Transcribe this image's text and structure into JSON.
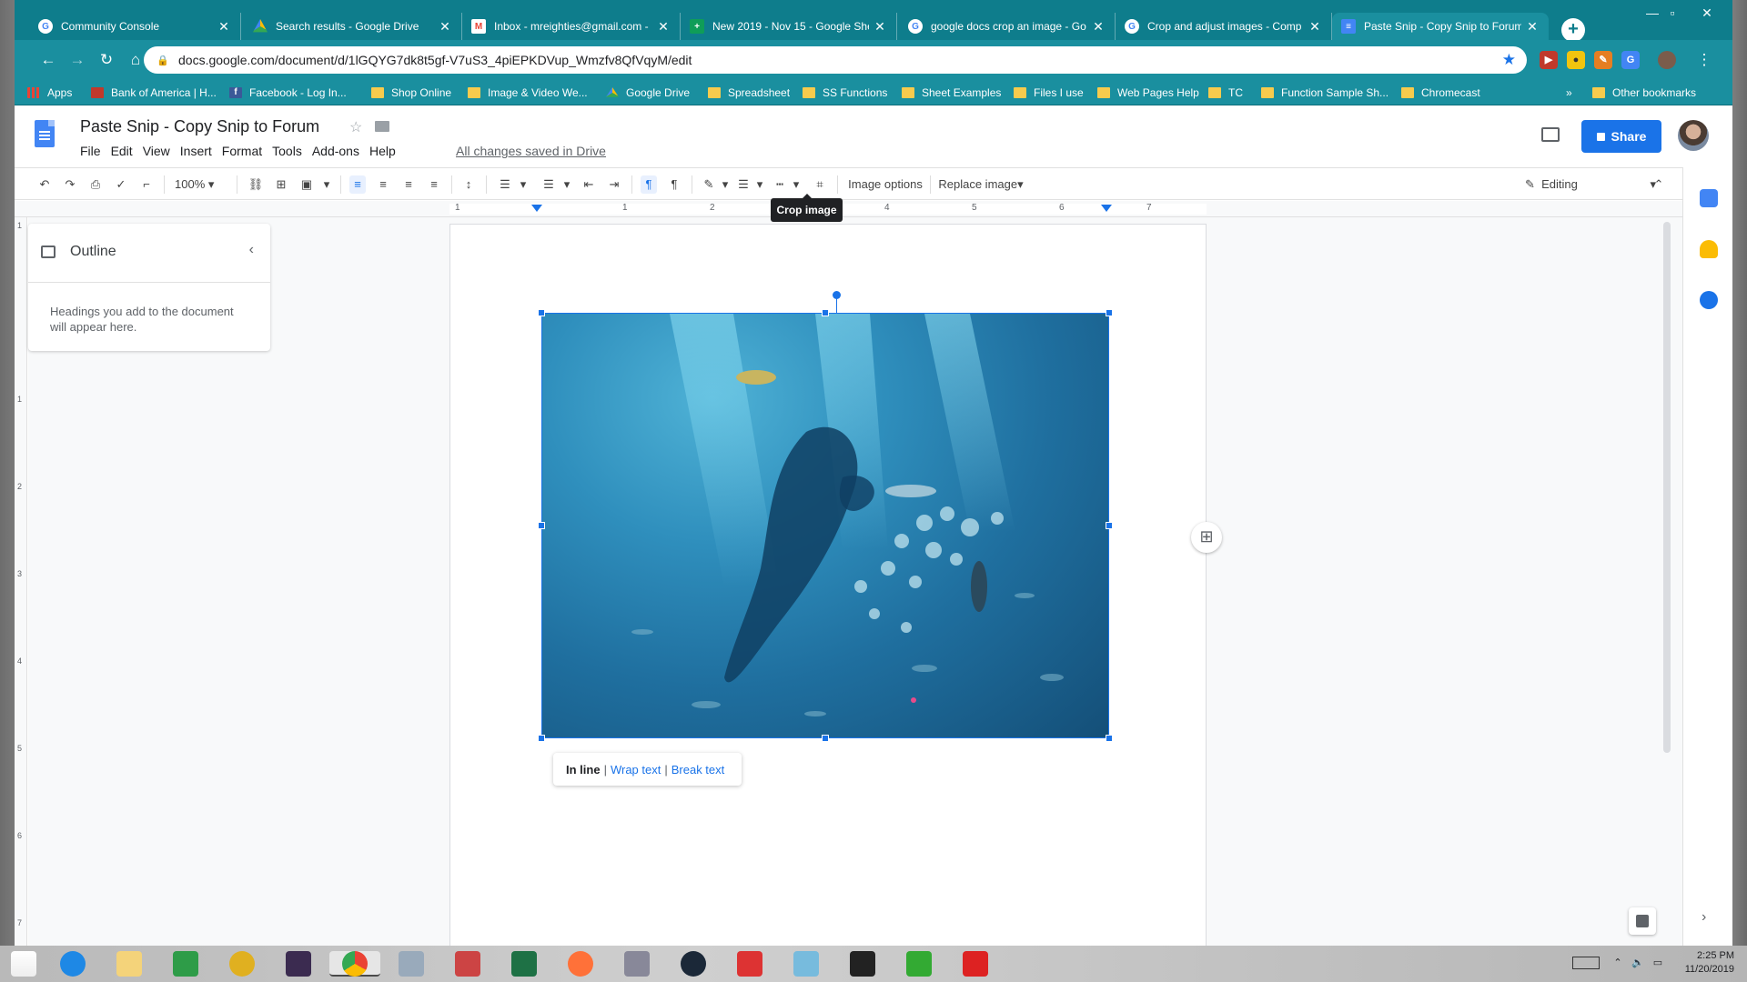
{
  "tabs": [
    {
      "title": "Community Console",
      "favicon": "google"
    },
    {
      "title": "Search results - Google Drive",
      "favicon": "drive"
    },
    {
      "title": "Inbox - mreighties@gmail.com -",
      "favicon": "gmail"
    },
    {
      "title": "New 2019 - Nov 15 - Google She",
      "favicon": "sheets"
    },
    {
      "title": "google docs crop an image - Go",
      "favicon": "google"
    },
    {
      "title": "Crop and adjust images - Comp",
      "favicon": "google"
    },
    {
      "title": "Paste Snip - Copy Snip to Forum",
      "favicon": "docs",
      "active": true
    }
  ],
  "omnibox": {
    "url": "docs.google.com/document/d/1lGQYG7dk8t5gf-V7uS3_4piEPKDVup_Wmzfv8QfVqyM/edit"
  },
  "bookmarks": [
    {
      "label": "Apps",
      "icon": "apps-icon"
    },
    {
      "label": "Bank of America | H...",
      "icon": "bofa-icon"
    },
    {
      "label": "Facebook - Log In...",
      "icon": "facebook-icon"
    },
    {
      "label": "Shop Online",
      "icon": "folder-icon"
    },
    {
      "label": "Image & Video We...",
      "icon": "folder-icon"
    },
    {
      "label": "Google Drive",
      "icon": "drive-icon"
    },
    {
      "label": "Spreadsheet",
      "icon": "folder-icon"
    },
    {
      "label": "SS Functions",
      "icon": "folder-icon"
    },
    {
      "label": "Sheet Examples",
      "icon": "folder-icon"
    },
    {
      "label": "Files I use",
      "icon": "folder-icon"
    },
    {
      "label": "Web Pages Help",
      "icon": "folder-icon"
    },
    {
      "label": "TC",
      "icon": "folder-icon"
    },
    {
      "label": "Function Sample Sh...",
      "icon": "folder-icon"
    },
    {
      "label": "Chromecast",
      "icon": "folder-icon"
    }
  ],
  "bookmarks_more": "»",
  "other_bookmarks": "Other bookmarks",
  "doc": {
    "title": "Paste Snip - Copy Snip to Forum",
    "menu": [
      "File",
      "Edit",
      "View",
      "Insert",
      "Format",
      "Tools",
      "Add-ons",
      "Help"
    ],
    "saved_status": "All changes saved in Drive",
    "share_label": "Share"
  },
  "toolbar": {
    "zoom": "100%",
    "image_options": "Image options",
    "replace_image": "Replace image",
    "mode": "Editing",
    "tooltip": "Crop image"
  },
  "ruler": {
    "numbers": [
      "1",
      "1",
      "2",
      "3",
      "4",
      "5",
      "6",
      "7"
    ]
  },
  "vruler": {
    "numbers": [
      "1",
      "1",
      "2",
      "3",
      "4",
      "5",
      "6",
      "7"
    ]
  },
  "outline": {
    "title": "Outline",
    "hint": "Headings you add to the document will appear here."
  },
  "wrap": {
    "inline": "In line",
    "wrap": "Wrap text",
    "break": "Break text",
    "separator": "|"
  },
  "taskbar": {
    "time": "2:25 PM",
    "date": "11/20/2019"
  },
  "colors": {
    "chrome_theme": "#0e7d8c",
    "accent": "#1a73e8"
  }
}
